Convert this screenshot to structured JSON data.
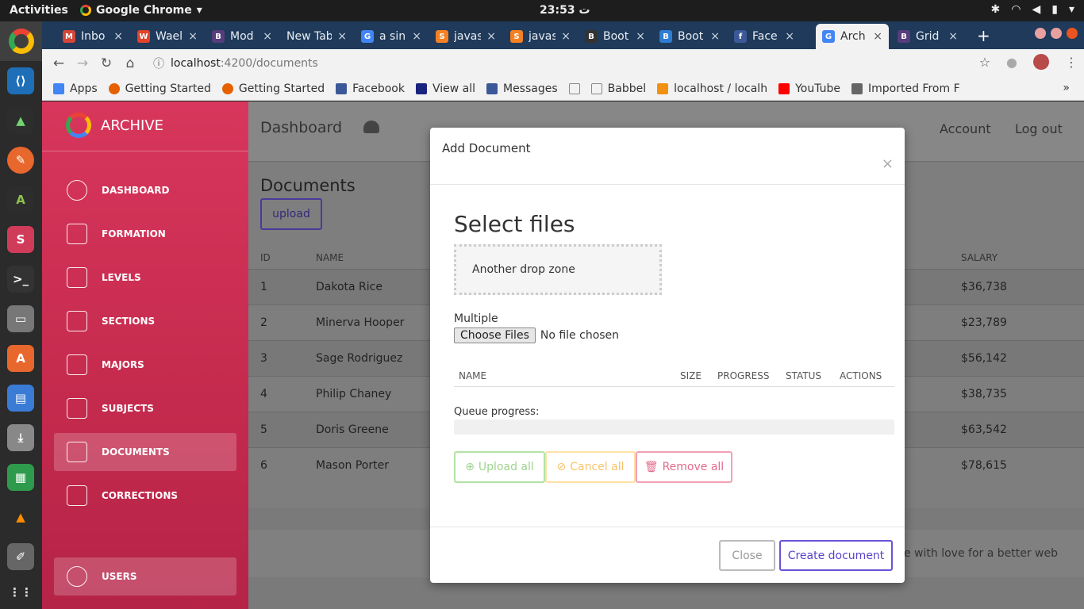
{
  "system": {
    "activities": "Activities",
    "app_name": "Google Chrome",
    "clock": "23:53 ت"
  },
  "browser": {
    "tabs": [
      {
        "label": "Inbo",
        "color": "#d44638",
        "glyph": "M"
      },
      {
        "label": "Wael",
        "color": "#e24329",
        "glyph": "W"
      },
      {
        "label": "Mod",
        "color": "#563d7c",
        "glyph": "B"
      },
      {
        "label": "New Tab",
        "color": "transparent",
        "glyph": ""
      },
      {
        "label": "a sin",
        "color": "#4285f4",
        "glyph": "G"
      },
      {
        "label": "javas",
        "color": "#f48024",
        "glyph": "S"
      },
      {
        "label": "javas",
        "color": "#f48024",
        "glyph": "S"
      },
      {
        "label": "Boot",
        "color": "#333333",
        "glyph": "B"
      },
      {
        "label": "Boot",
        "color": "#2d7dd2",
        "glyph": "B"
      },
      {
        "label": "Face",
        "color": "#3b5998",
        "glyph": "f"
      },
      {
        "label": "Arch",
        "color": "#4285f4",
        "glyph": "G"
      },
      {
        "label": "Grid",
        "color": "#563d7c",
        "glyph": "B"
      }
    ],
    "url_host": "localhost",
    "url_path": ":4200/documents",
    "bookmarks": [
      {
        "label": "Apps",
        "color": "#4285f4"
      },
      {
        "label": "Getting Started",
        "color": "#e66000"
      },
      {
        "label": "Getting Started",
        "color": "#e66000"
      },
      {
        "label": "Facebook",
        "color": "#3b5998"
      },
      {
        "label": "View all",
        "color": "#1a237e"
      },
      {
        "label": "Messages",
        "color": "#3b5998"
      },
      {
        "label": "",
        "color": "#bbbbbb"
      },
      {
        "label": "Babbel",
        "color": "#bbbbbb"
      },
      {
        "label": "localhost / localh",
        "color": "#f29111"
      },
      {
        "label": "YouTube",
        "color": "#ff0000"
      },
      {
        "label": "Imported From F",
        "color": "#666666"
      }
    ]
  },
  "app": {
    "brand": "ARCHIVE",
    "nav": [
      {
        "label": "DASHBOARD"
      },
      {
        "label": "FORMATION"
      },
      {
        "label": "LEVELS"
      },
      {
        "label": "SECTIONS"
      },
      {
        "label": "MAJORS"
      },
      {
        "label": "SUBJECTS"
      },
      {
        "label": "DOCUMENTS",
        "active": true
      },
      {
        "label": "CORRECTIONS"
      }
    ],
    "users_label": "USERS",
    "header": {
      "title": "Dashboard",
      "account": "Account",
      "logout": "Log out"
    },
    "documents": {
      "title": "Documents",
      "upload_label": "upload",
      "columns": {
        "id": "ID",
        "name": "NAME",
        "salary": "SALARY"
      },
      "rows": [
        {
          "id": "1",
          "name": "Dakota Rice",
          "salary": "$36,738"
        },
        {
          "id": "2",
          "name": "Minerva Hooper",
          "salary": "$23,789"
        },
        {
          "id": "3",
          "name": "Sage Rodriguez",
          "salary": "$56,142"
        },
        {
          "id": "4",
          "name": "Philip Chaney",
          "salary": "$38,735"
        },
        {
          "id": "5",
          "name": "Doris Greene",
          "salary": "$63,542"
        },
        {
          "id": "6",
          "name": "Mason Porter",
          "salary": "$78,615"
        }
      ]
    },
    "footer": "made with love for a better web"
  },
  "modal": {
    "title": "Add Document",
    "close_x": "×",
    "select_title": "Select files",
    "dropzone": "Another drop zone",
    "multiple_label": "Multiple",
    "choose_files": "Choose Files",
    "no_file": "No file chosen",
    "queue_columns": {
      "name": "NAME",
      "size": "SIZE",
      "progress": "PROGRESS",
      "status": "STATUS",
      "actions": "ACTIONS"
    },
    "queue_progress_label": "Queue progress:",
    "queue_progress": 0,
    "upload_all": "Upload all",
    "cancel_all": "Cancel all",
    "remove_all": "Remove all",
    "close": "Close",
    "create": "Create document"
  }
}
